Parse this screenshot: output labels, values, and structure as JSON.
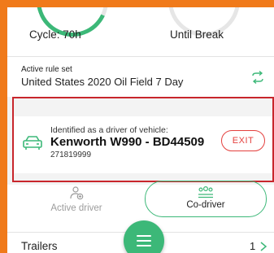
{
  "timers": {
    "cycle_label": "Cycle: 70h",
    "break_label": "Until Break"
  },
  "ruleset": {
    "caption": "Active rule set",
    "value": "United States 2020 Oil Field 7 Day"
  },
  "driver": {
    "caption": "Identified as a driver of vehicle:",
    "vehicle_name": "Kenworth W990 - BD44509",
    "vehicle_id": "271819999",
    "exit_label": "EXIT"
  },
  "roles": {
    "active_label": "Active driver",
    "codriver_label": "Co-driver",
    "selected": "Co-driver"
  },
  "trailers": {
    "label": "Trailers",
    "count": "1"
  },
  "colors": {
    "frame": "#f07a1a",
    "accent_green": "#3cb878",
    "highlight_red": "#c8262c",
    "exit_red": "#e4403e"
  },
  "icons": {
    "swap": "swap-arrows-icon",
    "vehicle": "car-icon",
    "active_driver": "person-add-icon",
    "co_driver": "group-icon",
    "menu": "hamburger-icon",
    "chevron": "chevron-right-icon"
  }
}
